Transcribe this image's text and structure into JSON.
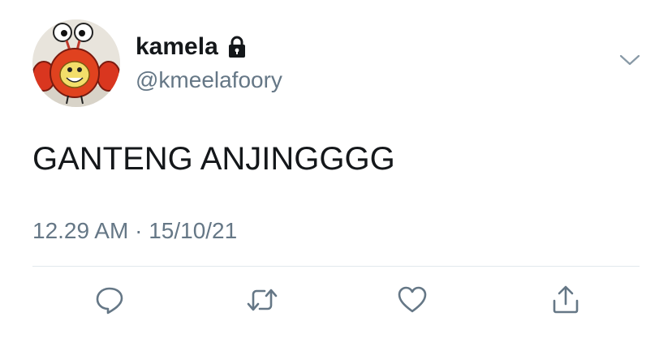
{
  "tweet": {
    "display_name": "kamela",
    "handle": "@kmeelafoory",
    "text": "GANTENG ANJINGGGG",
    "time": "12.29 AM",
    "separator": "·",
    "date": "15/10/21",
    "protected": true
  },
  "icons": {
    "lock": "lock-icon",
    "caret": "chevron-down-icon",
    "reply": "reply-icon",
    "retweet": "retweet-icon",
    "like": "heart-icon",
    "share": "share-icon"
  },
  "colors": {
    "text": "#14171a",
    "secondary": "#657786",
    "divider": "#e1e8ed",
    "icon": "#657786"
  }
}
